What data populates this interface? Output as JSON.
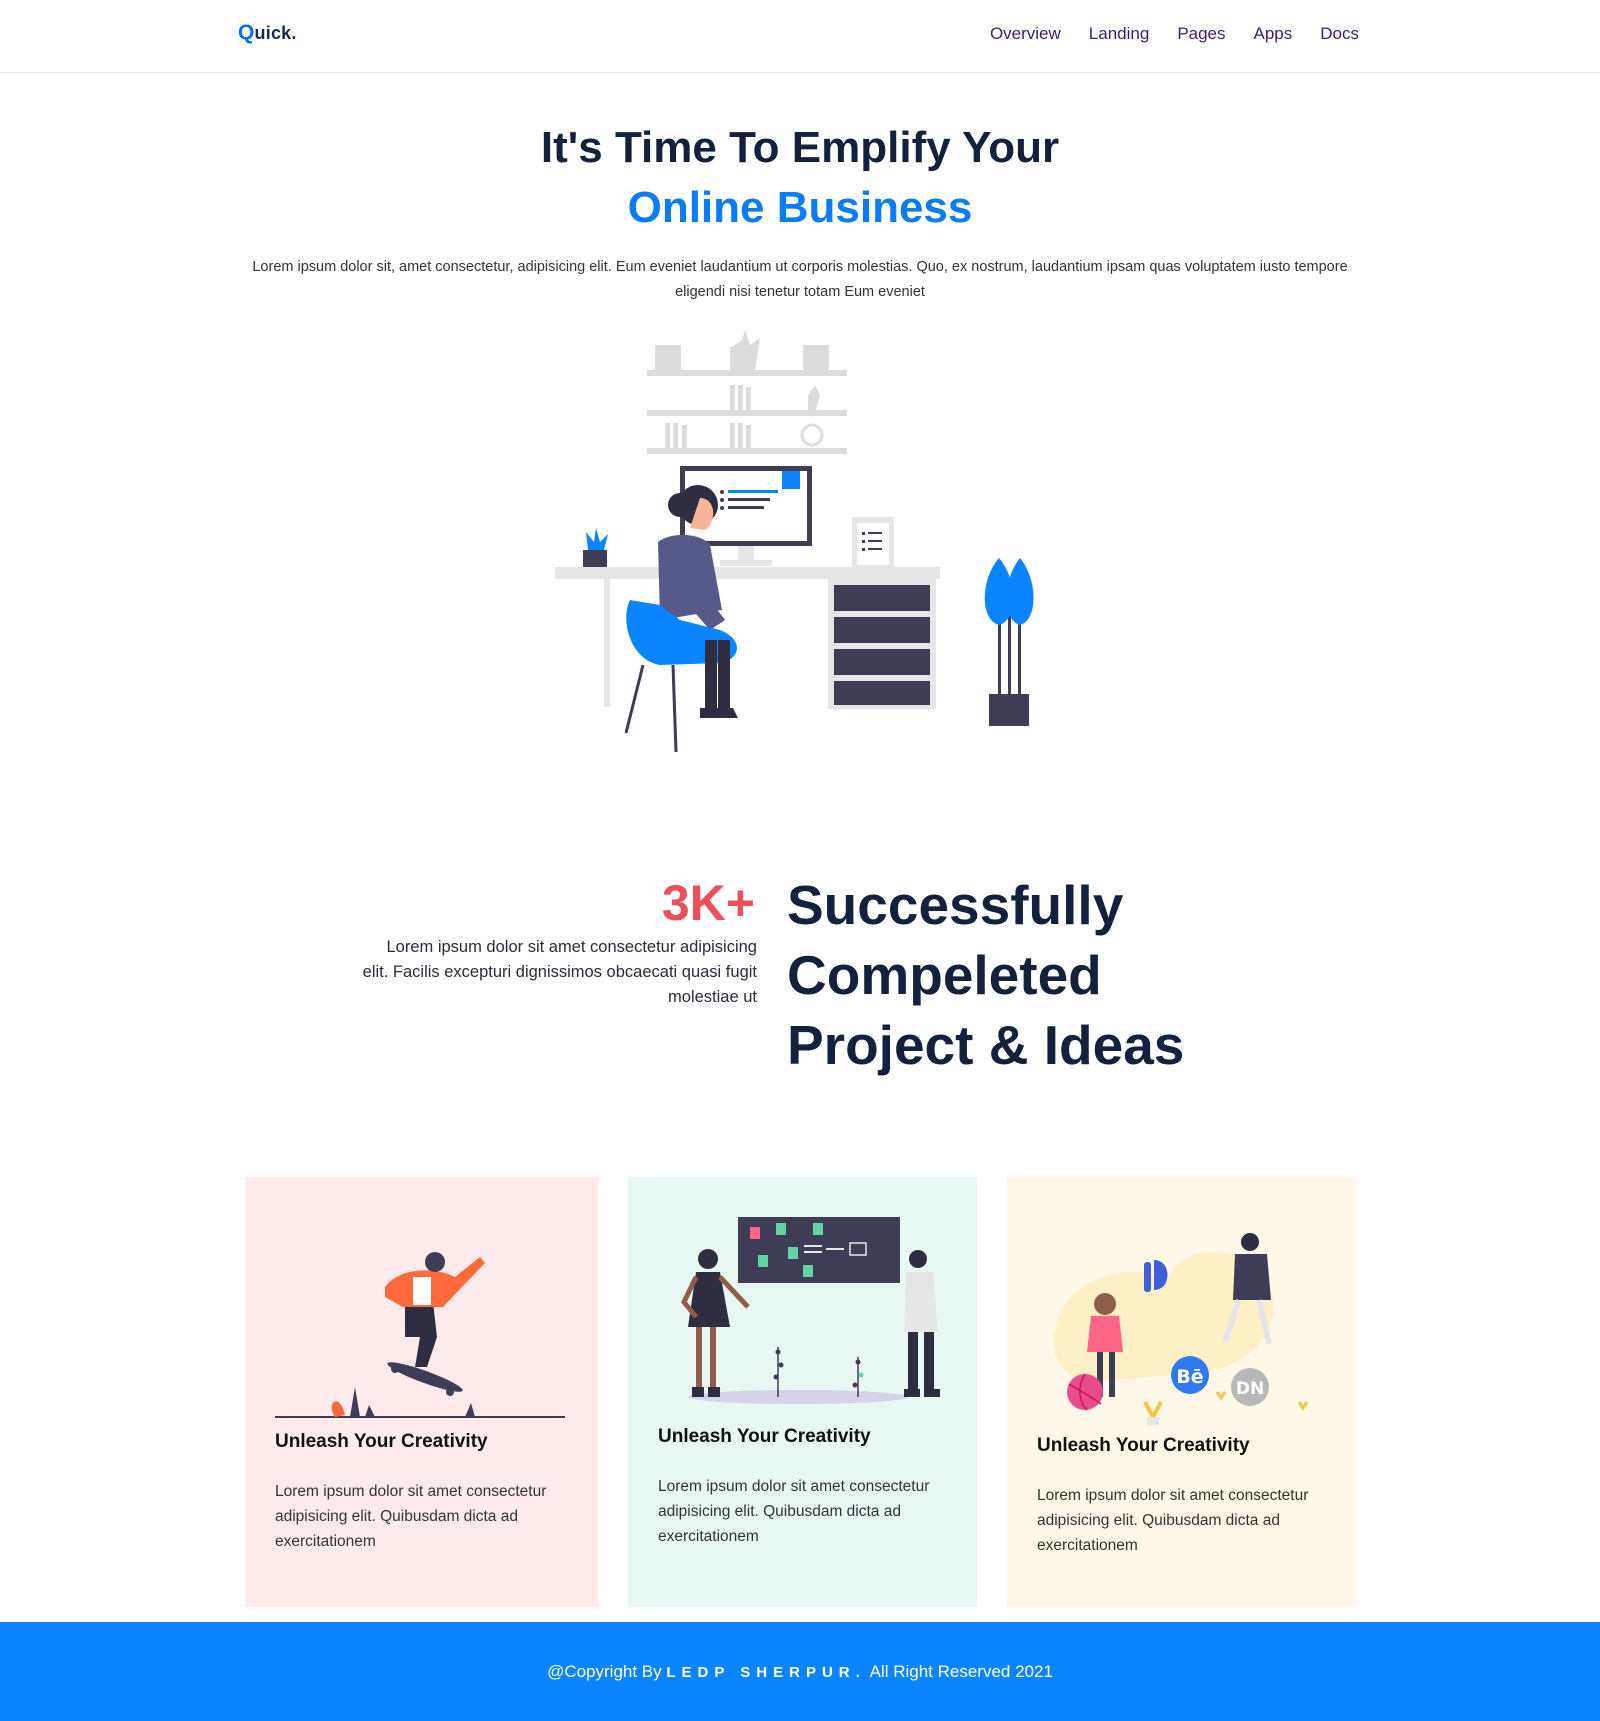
{
  "nav": {
    "logo_initial": "Q",
    "logo_rest": "uick.",
    "links": [
      "Overview",
      "Landing",
      "Pages",
      "Apps",
      "Docs"
    ]
  },
  "hero": {
    "title_line1": "It's Time To Emplify Your",
    "title_line2": "Online Business",
    "description": "Lorem ipsum dolor sit, amet consectetur, adipisicing elit. Eum eveniet laudantium ut corporis molestias. Quo, ex nostrum, laudantium ipsam quas voluptatem iusto tempore eligendi nisi tenetur totam Eum eveniet"
  },
  "stats": {
    "number": "3K+",
    "description": "Lorem ipsum dolor sit amet consectetur adipisicing elit. Facilis excepturi dignissimos obcaecati quasi fugit molestiae ut",
    "heading_line1": "Successfully",
    "heading_line2": "Compeleted",
    "heading_line3": "Project & Ideas"
  },
  "cards": [
    {
      "title": "Unleash Your Creativity",
      "text": "Lorem ipsum dolor sit amet consectetur adipisicing elit. Quibusdam dicta ad exercitationem"
    },
    {
      "title": "Unleash Your Creativity",
      "text": "Lorem ipsum dolor sit amet consectetur adipisicing elit. Quibusdam dicta ad exercitationem"
    },
    {
      "title": "Unleash Your Creativity",
      "text": "Lorem ipsum dolor sit amet consectetur adipisicing elit. Quibusdam dicta ad exercitationem"
    }
  ],
  "card3_badges": {
    "behance": "Bē",
    "dribbble_dn": "DN"
  },
  "footer": {
    "prefix": "@Copyright By",
    "brand": "LEDP SHERPUR.",
    "suffix": "All Right Reserved 2021"
  },
  "colors": {
    "brand_blue": "#0a7cf5",
    "navy": "#14213d",
    "accent_red": "#ee4f5c",
    "footer_blue": "#0a84ff"
  }
}
